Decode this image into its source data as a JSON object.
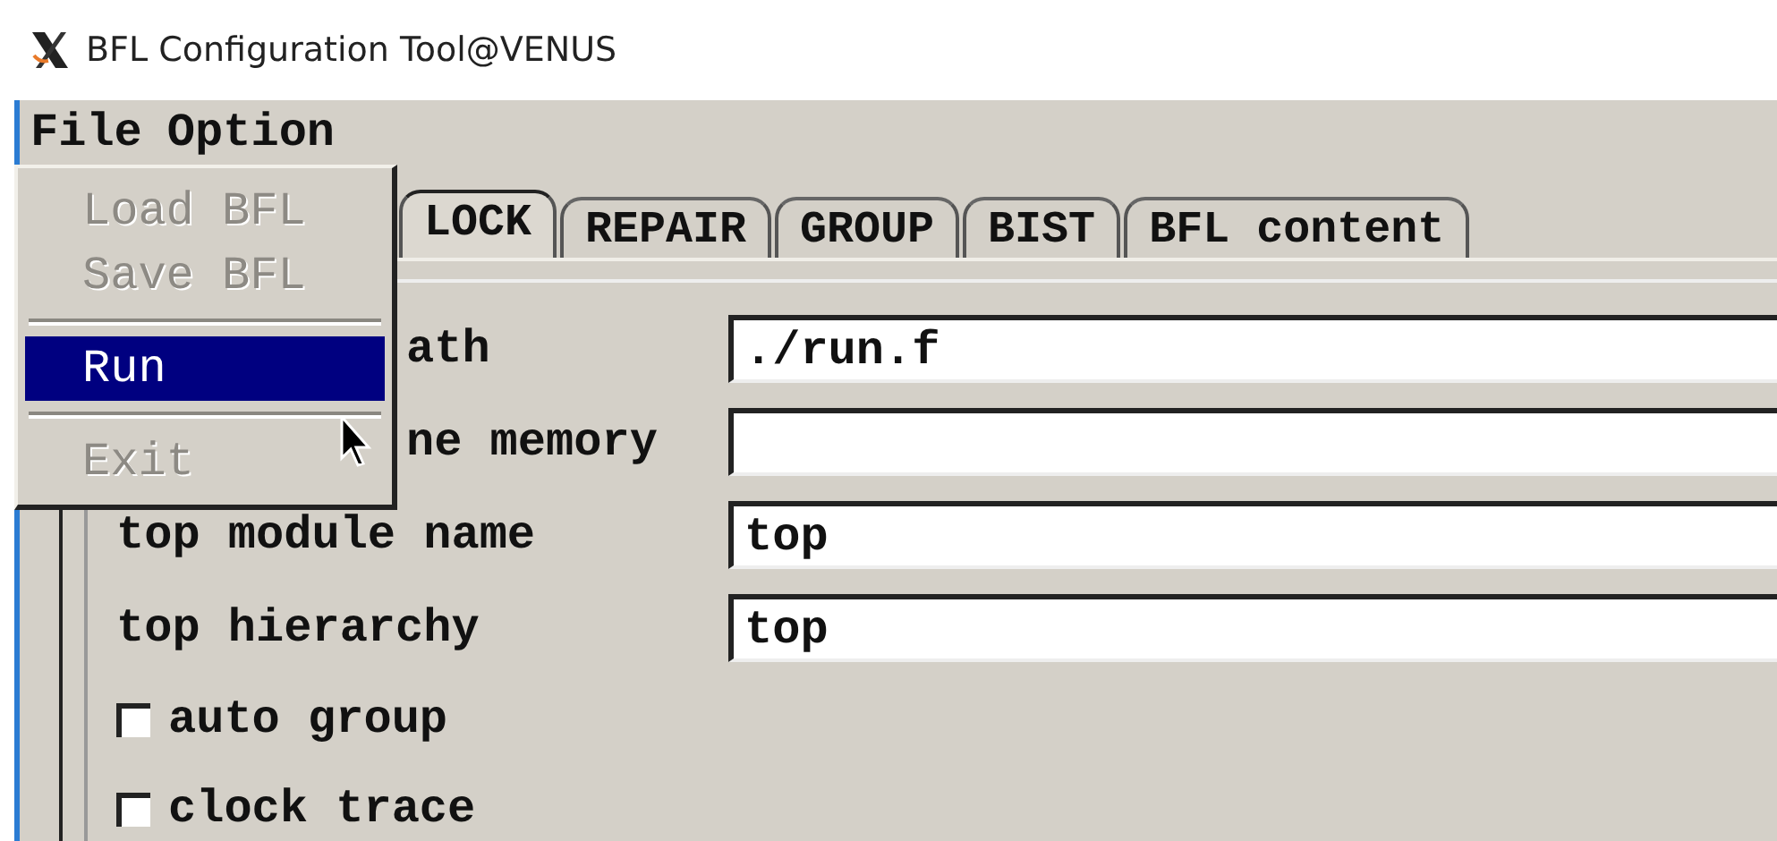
{
  "window": {
    "title": "BFL Configuration Tool@VENUS"
  },
  "menubar": [
    {
      "label": "File",
      "selected": true
    },
    {
      "label": "Option",
      "selected": false
    }
  ],
  "file_menu": [
    {
      "kind": "item",
      "label": "Load BFL",
      "disabled": true,
      "selected": false
    },
    {
      "kind": "item",
      "label": "Save BFL",
      "disabled": true,
      "selected": false
    },
    {
      "kind": "separator"
    },
    {
      "kind": "item",
      "label": "Run",
      "disabled": false,
      "selected": true
    },
    {
      "kind": "separator"
    },
    {
      "kind": "item",
      "label": "Exit",
      "disabled": true,
      "selected": false
    }
  ],
  "tabs": [
    {
      "label": "LOCK",
      "selected": true
    },
    {
      "label": "REPAIR",
      "selected": false
    },
    {
      "label": "GROUP",
      "selected": false
    },
    {
      "label": "BIST",
      "selected": false
    },
    {
      "label": "BFL content",
      "selected": false
    }
  ],
  "fields": [
    {
      "label": "ath",
      "value": "./run.f",
      "covered": true
    },
    {
      "label": "ne memory",
      "covered": true
    },
    {
      "label": "top module name",
      "value": "top",
      "covered": false
    },
    {
      "label": "top hierarchy",
      "value": "top",
      "covered": false
    }
  ],
  "checkboxes": [
    {
      "label": "auto group",
      "checked": false
    },
    {
      "label": "clock trace",
      "checked": false
    }
  ]
}
